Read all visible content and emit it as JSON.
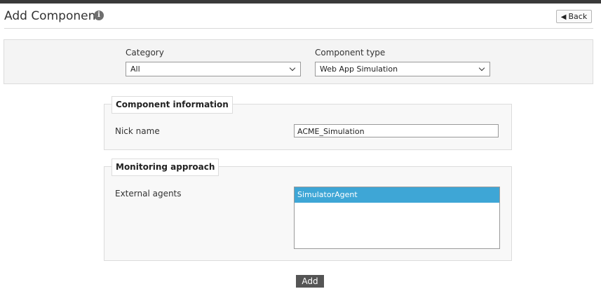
{
  "header": {
    "title": "Add Component",
    "info_icon": "info-icon",
    "info_glyph": "i",
    "back_label": "Back",
    "back_icon": "reply-arrow-icon"
  },
  "filters": {
    "category_label": "Category",
    "category_value": "All",
    "component_type_label": "Component type",
    "component_type_value": "Web App Simulation"
  },
  "component_information": {
    "legend": "Component information",
    "nick_name_label": "Nick name",
    "nick_name_value": "ACME_Simulation"
  },
  "monitoring_approach": {
    "legend": "Monitoring approach",
    "external_agents_label": "External agents",
    "agents": [
      "SimulatorAgent"
    ],
    "selected_color": "#3ea6d6"
  },
  "actions": {
    "add_label": "Add"
  }
}
